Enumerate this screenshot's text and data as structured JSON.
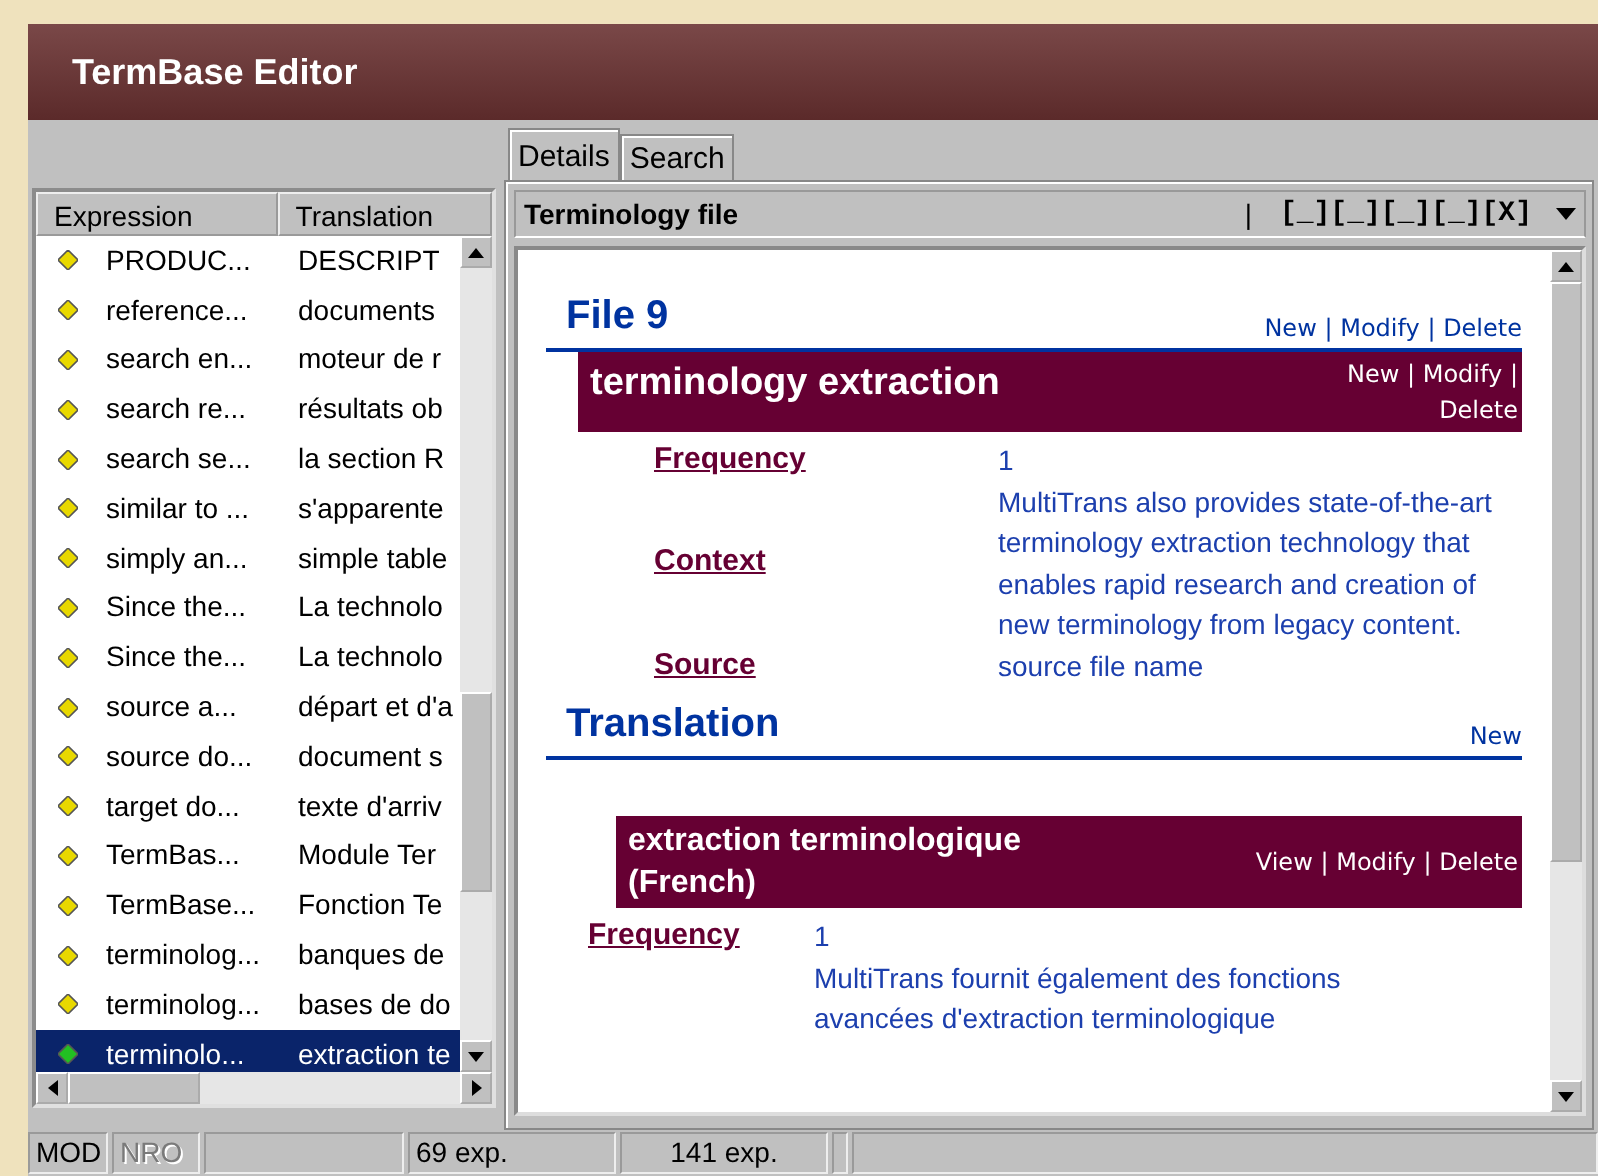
{
  "window": {
    "title": "TermBase Editor"
  },
  "list": {
    "columns": [
      "Expression",
      "Translation"
    ],
    "rows": [
      {
        "expression": "PRODUC...",
        "translation": "DESCRIPT",
        "selected": false
      },
      {
        "expression": "reference...",
        "translation": "documents",
        "selected": false
      },
      {
        "expression": "search en...",
        "translation": "moteur de r",
        "selected": false
      },
      {
        "expression": "search re...",
        "translation": "résultats ob",
        "selected": false
      },
      {
        "expression": "search se...",
        "translation": "la section R",
        "selected": false
      },
      {
        "expression": "similar to ...",
        "translation": "s'apparente",
        "selected": false
      },
      {
        "expression": "simply an...",
        "translation": "simple table",
        "selected": false
      },
      {
        "expression": "Since the...",
        "translation": "La technolo",
        "selected": false
      },
      {
        "expression": "Since the...",
        "translation": "La technolo",
        "selected": false
      },
      {
        "expression": "source a...",
        "translation": "départ et d'a",
        "selected": false
      },
      {
        "expression": "source do...",
        "translation": "document s",
        "selected": false
      },
      {
        "expression": "target do...",
        "translation": "texte d'arriv",
        "selected": false
      },
      {
        "expression": "TermBas...",
        "translation": "Module Ter",
        "selected": false
      },
      {
        "expression": "TermBase...",
        "translation": "Fonction Te",
        "selected": false
      },
      {
        "expression": "terminolog...",
        "translation": "banques de",
        "selected": false
      },
      {
        "expression": "terminolog...",
        "translation": "bases de do",
        "selected": false
      },
      {
        "expression": "terminolo...",
        "translation": "extraction te",
        "selected": true
      }
    ]
  },
  "tabs": [
    {
      "label": "Details",
      "selected": true
    },
    {
      "label": "Search",
      "selected": false
    }
  ],
  "panel": {
    "title": "Terminology file",
    "separator": "|",
    "window_buttons": "[_][_][_][_][X]"
  },
  "entry": {
    "file_heading": "File 9",
    "link_separator": "|",
    "file_actions": [
      "New",
      "Modify",
      "Delete"
    ],
    "term": "terminology extraction",
    "term_actions": [
      "New",
      "Modify",
      "Delete"
    ],
    "fields": [
      {
        "label": "Frequency",
        "value": "1"
      },
      {
        "label": "Context",
        "value": "MultiTrans also provides state-of-the-art terminology extraction technology that enables rapid research and creation of new terminology from legacy content."
      },
      {
        "label": "Source",
        "value": "source file name"
      }
    ],
    "translation_heading": "Translation",
    "translation_actions": [
      "New"
    ],
    "translation": {
      "term": "extraction terminologique (French)",
      "actions": [
        "View",
        "Modify",
        "Delete"
      ],
      "fields": [
        {
          "label": "Frequency",
          "value": "1"
        },
        {
          "value": "MultiTrans fournit également des fonctions avancées d'extraction terminologique"
        }
      ]
    }
  },
  "status_bar": [
    {
      "text": "MOD",
      "disabled": false
    },
    {
      "text": "NRO",
      "disabled": true
    },
    {
      "text": "69 exp.",
      "disabled": false
    },
    {
      "text": "141 exp.",
      "disabled": false
    }
  ]
}
